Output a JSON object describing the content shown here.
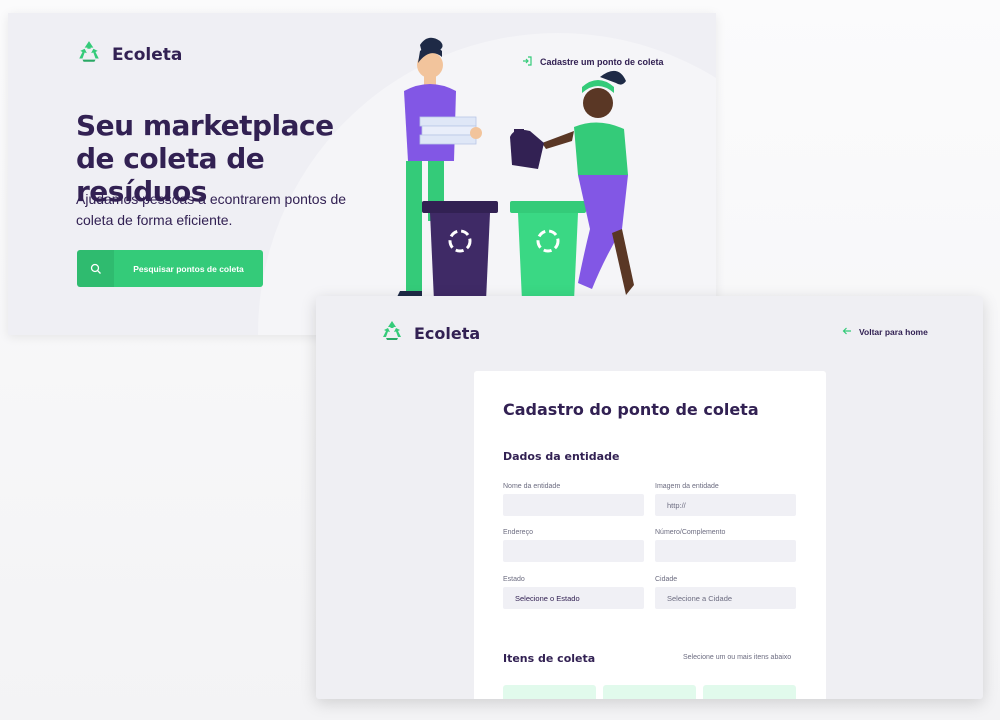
{
  "landing": {
    "logo_text": "Ecoleta",
    "register_link": "Cadastre um ponto de coleta",
    "title": "Seu marketplace de coleta de resíduos",
    "subtitle": "Ajudamos pessoas a econtrarem pontos de coleta de forma eficiente.",
    "search_button": "Pesquisar pontos de coleta"
  },
  "register": {
    "logo_text": "Ecoleta",
    "back_link": "Voltar para home",
    "form_title": "Cadastro do ponto de coleta",
    "section_entity": "Dados da entidade",
    "fields": {
      "name": {
        "label": "Nome da entidade",
        "value": ""
      },
      "image": {
        "label": "Imagem da entidade",
        "placeholder": "http://"
      },
      "address": {
        "label": "Endereço",
        "value": ""
      },
      "number": {
        "label": "Número/Complemento",
        "value": ""
      },
      "state": {
        "label": "Estado",
        "selected": "Selecione o Estado"
      },
      "city": {
        "label": "Cidade",
        "selected": "Selecione a Cidade"
      }
    },
    "section_items": "Itens de coleta",
    "items_hint": "Selecione um ou mais itens abaixo"
  },
  "colors": {
    "primary": "#34cb79",
    "title": "#322153",
    "text": "#6c6c80",
    "bin_dark": "#322153",
    "shirt_purple": "#8257e5"
  },
  "icons": [
    "recycle-icon",
    "login-arrow-icon",
    "search-icon",
    "arrow-left-icon"
  ]
}
